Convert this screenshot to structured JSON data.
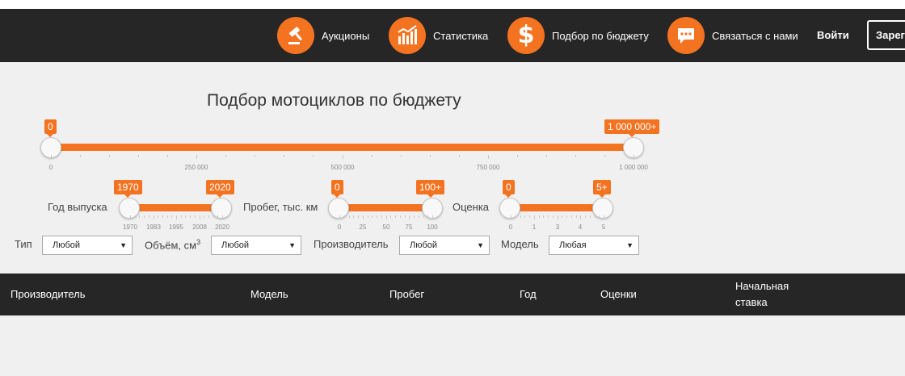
{
  "nav": {
    "items": [
      {
        "label": "Аукционы",
        "icon": "gavel-icon"
      },
      {
        "label": "Статистика",
        "icon": "bar-chart-icon"
      },
      {
        "label": "Подбор по бюджету",
        "icon": "dollar-icon"
      },
      {
        "label": "Связаться с нами",
        "icon": "chat-icon"
      }
    ],
    "login": "Войти",
    "register": "Зарег"
  },
  "title": "Подбор мотоциклов по бюджету",
  "colors": {
    "accent": "#f47321",
    "dark": "#262626",
    "background": "#f0f0f0"
  },
  "budget": {
    "min_label": "0",
    "max_label": "1 000 000+",
    "min_value": 0,
    "max_value": 1000000,
    "ticks": [
      "0",
      "250 000",
      "500 000",
      "750 000",
      "1 000 000"
    ]
  },
  "year": {
    "label": "Год выпуска",
    "min_label": "1970",
    "max_label": "2020",
    "ticks": [
      "1970",
      "1983",
      "1995",
      "2008",
      "2020"
    ]
  },
  "mileage": {
    "label": "Пробег, тыс. км",
    "min_label": "0",
    "max_label": "100+",
    "ticks": [
      "0",
      "25",
      "50",
      "75",
      "100"
    ]
  },
  "rating": {
    "label": "Оценка",
    "min_label": "0",
    "max_label": "5+",
    "ticks": [
      "0",
      "1",
      "3",
      "4",
      "5"
    ]
  },
  "filters": {
    "type": {
      "label": "Тип",
      "value": "Любой"
    },
    "volume": {
      "label": "Объём, см",
      "sup": "3",
      "value": "Любой"
    },
    "maker": {
      "label": "Производитель",
      "value": "Любой"
    },
    "model": {
      "label": "Модель",
      "value": "Любая"
    }
  },
  "table": {
    "columns": [
      "Производитель",
      "Модель",
      "Пробег",
      "Год",
      "Оценки",
      "Начальная ставка"
    ]
  }
}
